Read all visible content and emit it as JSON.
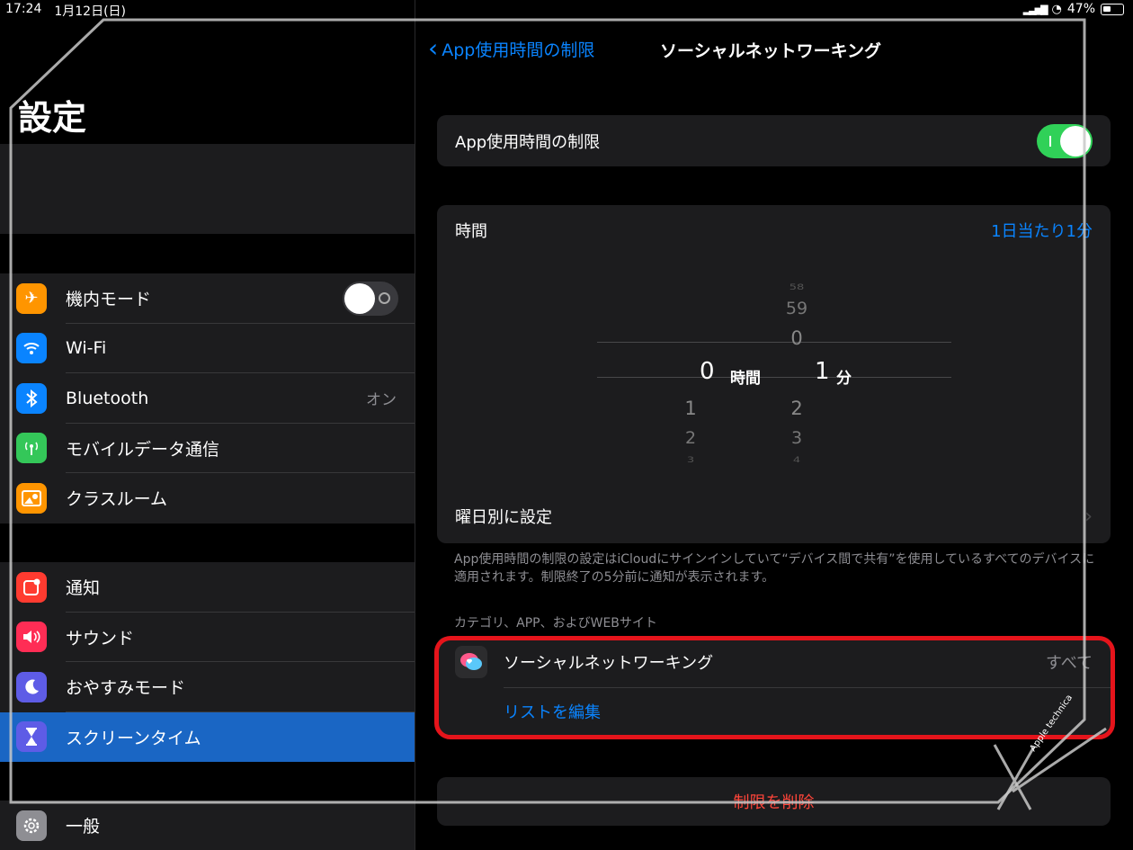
{
  "status": {
    "time": "17:24",
    "date": "1月12日(日)",
    "battery": "47%"
  },
  "sidebar": {
    "title": "設定",
    "group1": [
      {
        "label": "機内モード",
        "icon": "airplane-icon",
        "color": "#ff9500"
      },
      {
        "label": "Wi-Fi",
        "icon": "wifi-icon",
        "color": "#0a84ff"
      },
      {
        "label": "Bluetooth",
        "icon": "bluetooth-icon",
        "color": "#0a84ff",
        "value": "オン"
      },
      {
        "label": "モバイルデータ通信",
        "icon": "antenna-icon",
        "color": "#34c759"
      },
      {
        "label": "クラスルーム",
        "icon": "classroom-icon",
        "color": "#ff9500"
      }
    ],
    "group2": [
      {
        "label": "通知",
        "icon": "notification-icon",
        "color": "#ff3b30"
      },
      {
        "label": "サウンド",
        "icon": "speaker-icon",
        "color": "#ff2d55"
      },
      {
        "label": "おやすみモード",
        "icon": "moon-icon",
        "color": "#5e5ce6"
      },
      {
        "label": "スクリーンタイム",
        "icon": "hourglass-icon",
        "color": "#5e5ce6"
      }
    ],
    "group3": [
      {
        "label": "一般",
        "icon": "gear-icon",
        "color": "#8e8e93"
      }
    ]
  },
  "detail": {
    "back_label": "App使用時間の制限",
    "title": "ソーシャルネットワーキング",
    "limit_label": "App使用時間の制限",
    "time_label": "時間",
    "time_value": "1日当たり1分",
    "picker": {
      "hours_above": [
        "",
        "",
        ""
      ],
      "minutes_above": [
        "58",
        "59",
        "0"
      ],
      "hours_selected": "0",
      "hours_unit": "時間",
      "minutes_selected": "1",
      "minutes_unit": "分",
      "hours_below": [
        "1",
        "2",
        "3"
      ],
      "minutes_below": [
        "2",
        "3",
        "4"
      ]
    },
    "weekday_label": "曜日別に設定",
    "footnote": "App使用時間の制限の設定はiCloudにサインインしていて“デバイス間で共有”を使用しているすべてのデバイスに適用されます。制限終了の5分前に通知が表示されます。",
    "section_header": "カテゴリ、APP、およびWEBサイト",
    "category_label": "ソーシャルネットワーキング",
    "category_value": "すべて",
    "edit_list": "リストを編集",
    "delete_label": "制限を削除"
  },
  "watermark": {
    "text": "Apple technica"
  }
}
